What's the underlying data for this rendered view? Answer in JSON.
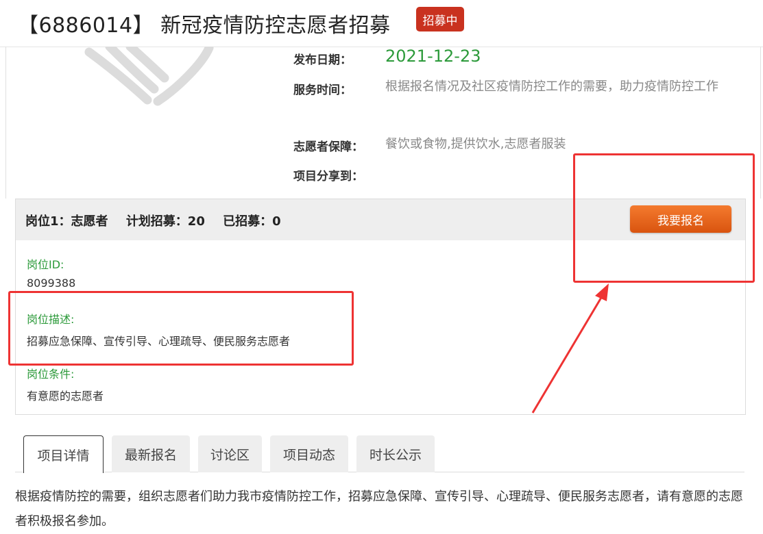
{
  "header": {
    "title": "【6886014】 新冠疫情防控志愿者招募",
    "status_badge": "招募中"
  },
  "info": {
    "publish_date_label": "发布日期：",
    "publish_date": "2021-12-23",
    "service_time_label": "服务时间：",
    "service_time": "根据报名情况及社区疫情防控工作的需要，助力疫情防控工作",
    "guarantee_label": "志愿者保障：",
    "guarantee": "餐饮或食物,提供饮水,志愿者服装",
    "share_label": "项目分享到："
  },
  "position": {
    "header_post": "岗位1：志愿者",
    "header_plan": "计划招募：20",
    "header_recruited": "已招募：0",
    "signup_button": "我要报名",
    "id_label": "岗位ID:",
    "id_value": "8099388",
    "desc_label": "岗位描述:",
    "desc_value": "招募应急保障、宣传引导、心理疏导、便民服务志愿者",
    "cond_label": "岗位条件:",
    "cond_value": "有意愿的志愿者"
  },
  "tabs": [
    {
      "label": "项目详情"
    },
    {
      "label": "最新报名"
    },
    {
      "label": "讨论区"
    },
    {
      "label": "项目动态"
    },
    {
      "label": "时长公示"
    }
  ],
  "detail": {
    "text": "根据疫情防控的需要，组织志愿者们助力我市疫情防控工作，招募应急保障、宣传引导、心理疏导、便民服务志愿者，请有意愿的志愿者积极报名参加。"
  },
  "colors": {
    "accent_green": "#2c9a3a",
    "badge_red": "#c9321f",
    "button_orange": "#e8651f",
    "annotation_red": "#ee3333"
  }
}
